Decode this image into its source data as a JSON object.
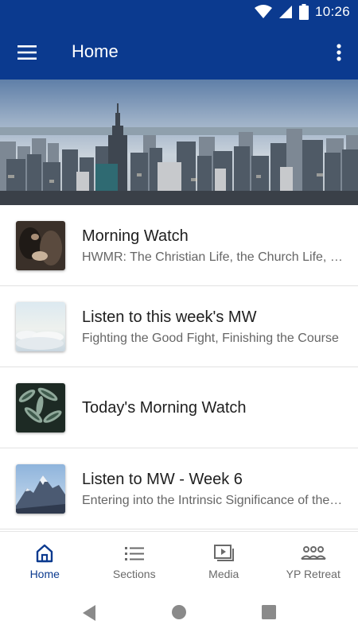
{
  "status": {
    "time": "10:26"
  },
  "appbar": {
    "title": "Home"
  },
  "list": [
    {
      "title": "Morning Watch",
      "subtitle": "HWMR: The Christian Life, the Church Life, the Kingdom of God"
    },
    {
      "title": "Listen to this week's MW",
      "subtitle": "Fighting the Good Fight, Finishing the Course"
    },
    {
      "title": "Today's Morning Watch",
      "subtitle": ""
    },
    {
      "title": "Listen to MW - Week 6",
      "subtitle": "Entering into the Intrinsic Significance of the Church"
    }
  ],
  "nav": [
    {
      "label": "Home",
      "icon": "home-icon",
      "active": true
    },
    {
      "label": "Sections",
      "icon": "list-icon",
      "active": false
    },
    {
      "label": "Media",
      "icon": "media-icon",
      "active": false
    },
    {
      "label": "YP Retreat",
      "icon": "group-icon",
      "active": false
    }
  ],
  "colors": {
    "primary": "#0b3a8f",
    "active_nav": "#0b3a8f",
    "inactive_nav": "#6a6a6a"
  }
}
